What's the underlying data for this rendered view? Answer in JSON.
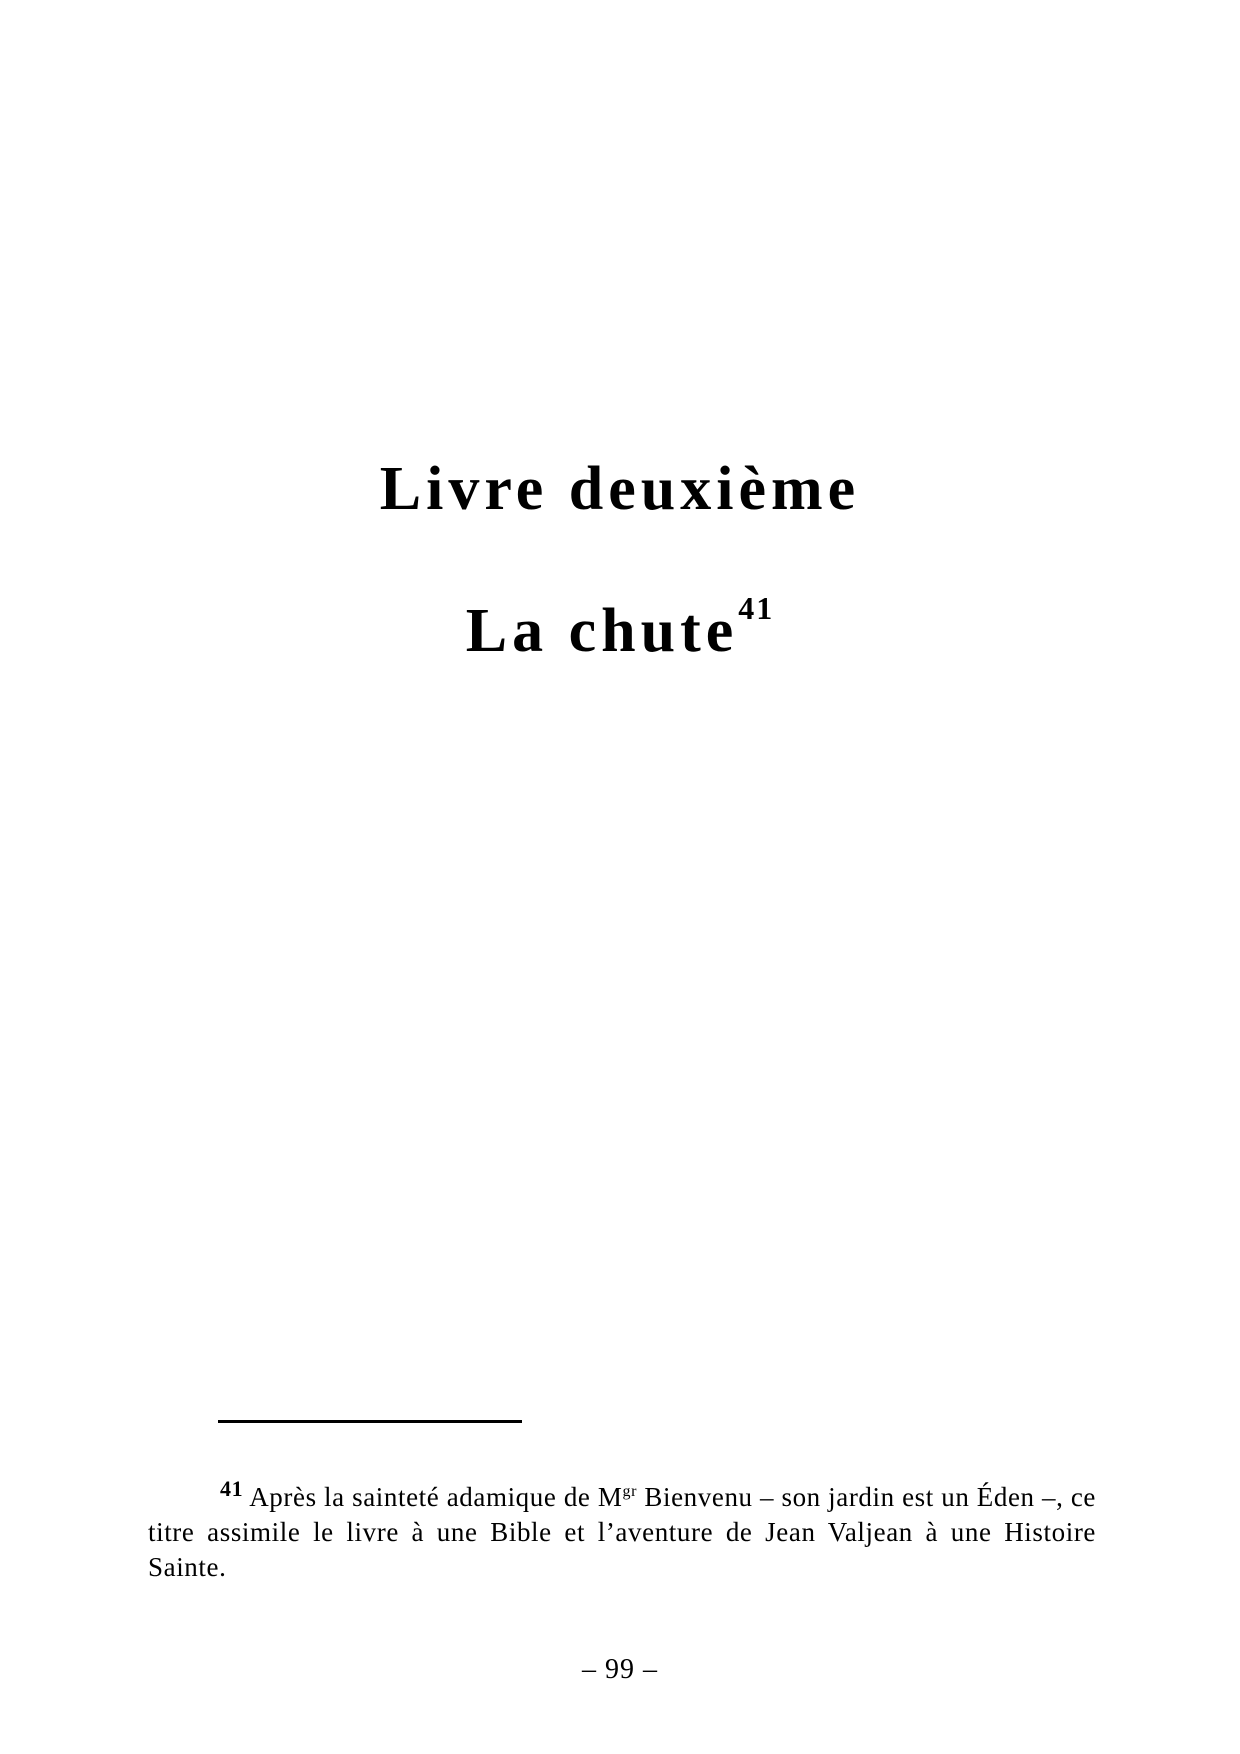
{
  "book": {
    "title": "Livre deuxième"
  },
  "part": {
    "title": "La chute",
    "footnote_marker": "41"
  },
  "footnote": {
    "number": "41",
    "text_before": "Après la sainteté adamique de M",
    "honorific_sup": "gr",
    "text_after": " Bienvenu – son jardin est un Éden –, ce titre assimile le livre à une Bible et l’aventure de Jean Valjean à une Histoire Sainte."
  },
  "page": {
    "number_label": "– 99 –"
  }
}
